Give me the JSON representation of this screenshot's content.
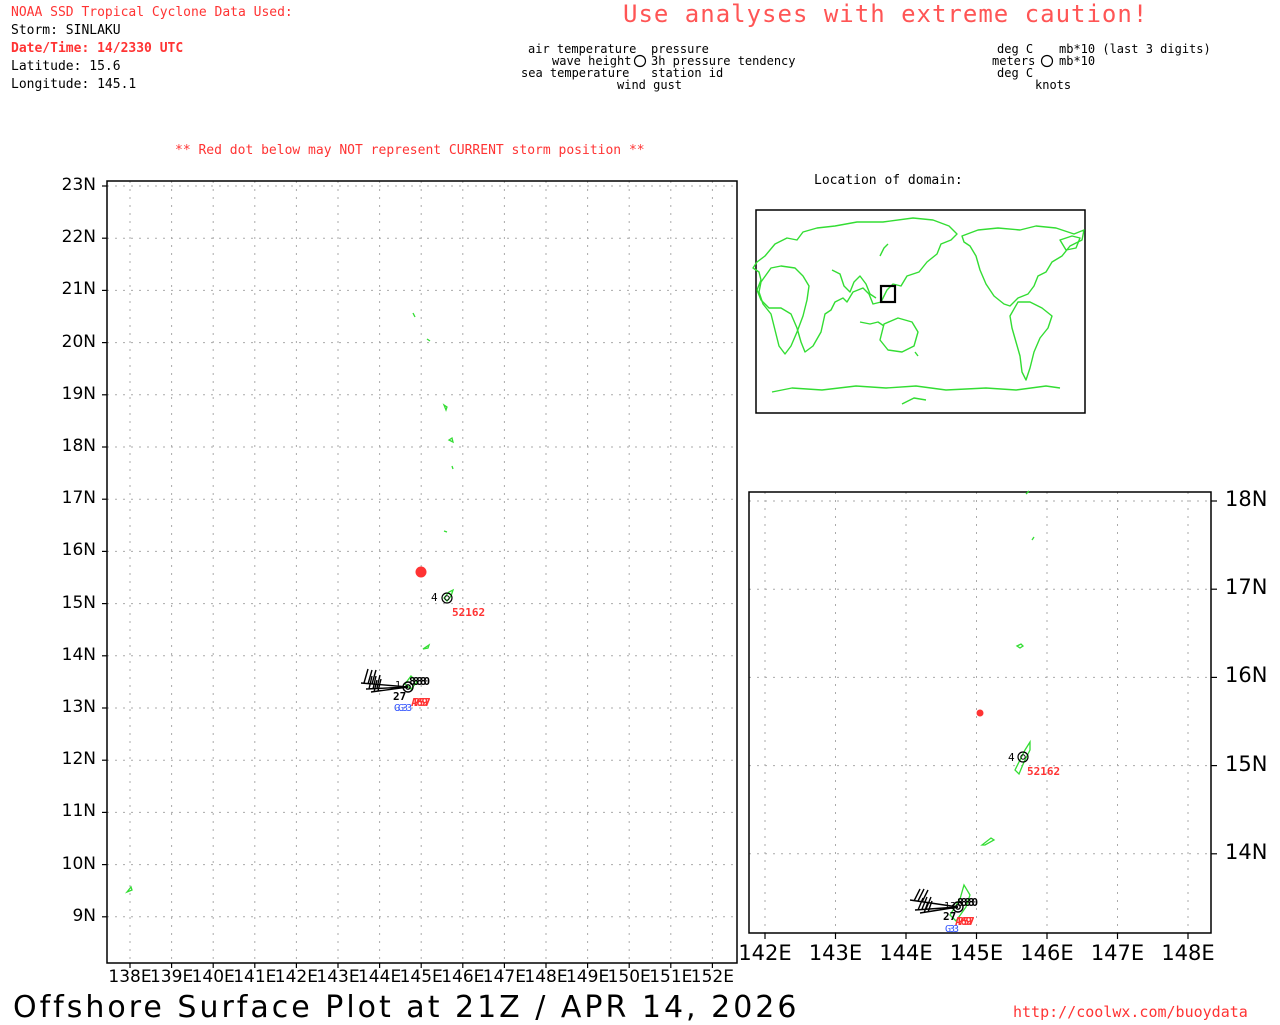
{
  "header": {
    "title": "NOAA SSD Tropical Cyclone Data Used:",
    "storm": "Storm: SINLAKU",
    "datetime": "Date/Time: 14/2330 UTC",
    "latitude": "Latitude: 15.6",
    "longitude": "Longitude: 145.1"
  },
  "warning": "Use analyses with extreme caution!",
  "legend_left": {
    "air_temperature": "air temperature",
    "pressure": "pressure",
    "wave_height": "wave height",
    "pressure_tendency": "3h pressure tendency",
    "sea_temperature": "sea temperature",
    "station_id": "station id",
    "wind_gust": "wind gust"
  },
  "legend_right": {
    "deg_c_1": "deg C",
    "mb_last3": "mb*10 (last 3 digits)",
    "meters": "meters",
    "mb10": "mb*10",
    "deg_c_2": "deg C",
    "knots": "knots"
  },
  "red_dot_note": "** Red dot below may NOT represent CURRENT storm position **",
  "location_of_domain": "Location of domain:",
  "main_map": {
    "lat_labels": [
      "23N",
      "22N",
      "21N",
      "20N",
      "19N",
      "18N",
      "17N",
      "16N",
      "15N",
      "14N",
      "13N",
      "12N",
      "11N",
      "10N",
      "9N"
    ],
    "lon_labels": [
      "138E",
      "139E",
      "140E",
      "141E",
      "142E",
      "143E",
      "144E",
      "145E",
      "146E",
      "147E",
      "148E",
      "149E",
      "150E",
      "151E",
      "152E"
    ]
  },
  "zoom_map": {
    "lat_labels": [
      "18N",
      "17N",
      "16N",
      "15N",
      "14N"
    ],
    "lon_labels": [
      "142E",
      "143E",
      "144E",
      "145E",
      "146E",
      "147E",
      "148E"
    ]
  },
  "stations": {
    "buoy_id": "52162",
    "buoy_value": "4",
    "guam_temp": "27",
    "guam_left_value": "1",
    "guam_code": "G",
    "guam_zoom_value": "13"
  },
  "footer": {
    "title": "Offshore Surface Plot at 21Z / APR 14, 2026",
    "url": "http://coolwx.com/buoydata"
  },
  "colors": {
    "land": "#33dd33",
    "storm": "#ff3333",
    "station_id": "#ff3333",
    "gust": "#3355ff",
    "grid": "#aaaaaa"
  }
}
